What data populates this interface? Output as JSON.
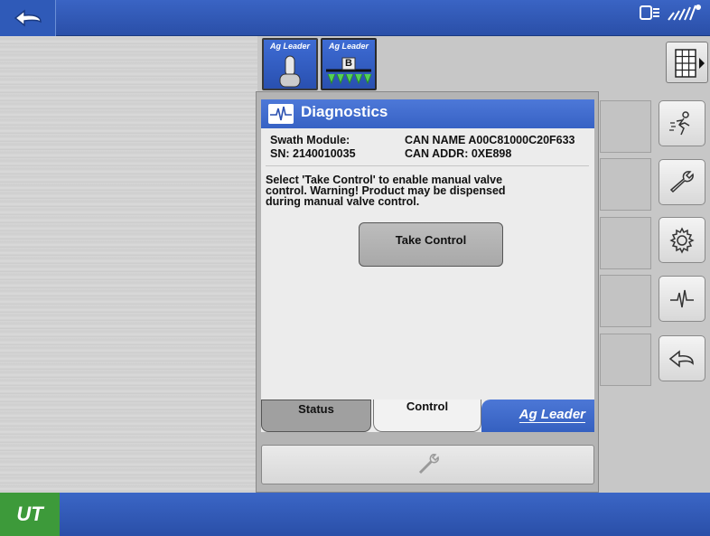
{
  "topbar": {
    "back_icon": "undo-arrow-icon",
    "status_icons": [
      "display-icon",
      "satellite-signal-icon"
    ]
  },
  "tool_tabs": [
    {
      "brand": "Ag Leader",
      "icon": "joystick-icon"
    },
    {
      "brand": "Ag Leader",
      "icon": "sprayer-boom-icon",
      "badge": "B"
    }
  ],
  "grid_button": {
    "icon": "grid-menu-icon"
  },
  "panel": {
    "title": "Diagnostics",
    "title_icon": "heartbeat-icon",
    "swath_module_label": "Swath Module:",
    "sn": "SN: 2140010035",
    "can_name": "CAN NAME A00C81000C20F633",
    "can_addr": "CAN ADDR:  0XE898",
    "message_lines": [
      "Select 'Take Control' to enable manual valve",
      "control. Warning! Product may be dispensed",
      "during manual valve control."
    ],
    "take_control_label": "Take Control"
  },
  "tabs": {
    "status": "Status",
    "control": "Control",
    "brand": "Ag Leader"
  },
  "bottom_button": {
    "icon": "wrench-icon"
  },
  "side_buttons": [
    "runner-icon",
    "wrench-icon",
    "gear-icon",
    "heartbeat-icon",
    "back-arrow-icon"
  ],
  "footer": {
    "ut_label": "UT"
  }
}
